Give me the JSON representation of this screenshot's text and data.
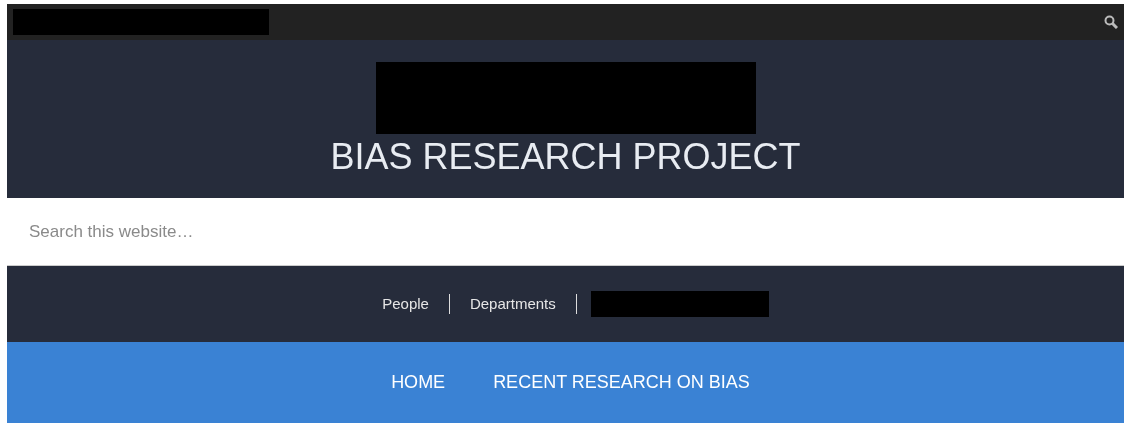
{
  "site_title": "BIAS RESEARCH PROJECT",
  "search": {
    "placeholder": "Search this website…"
  },
  "secondary_nav": [
    {
      "label": "People"
    },
    {
      "label": "Departments"
    }
  ],
  "primary_nav": [
    {
      "label": "HOME"
    },
    {
      "label": "RECENT RESEARCH ON BIAS"
    }
  ]
}
